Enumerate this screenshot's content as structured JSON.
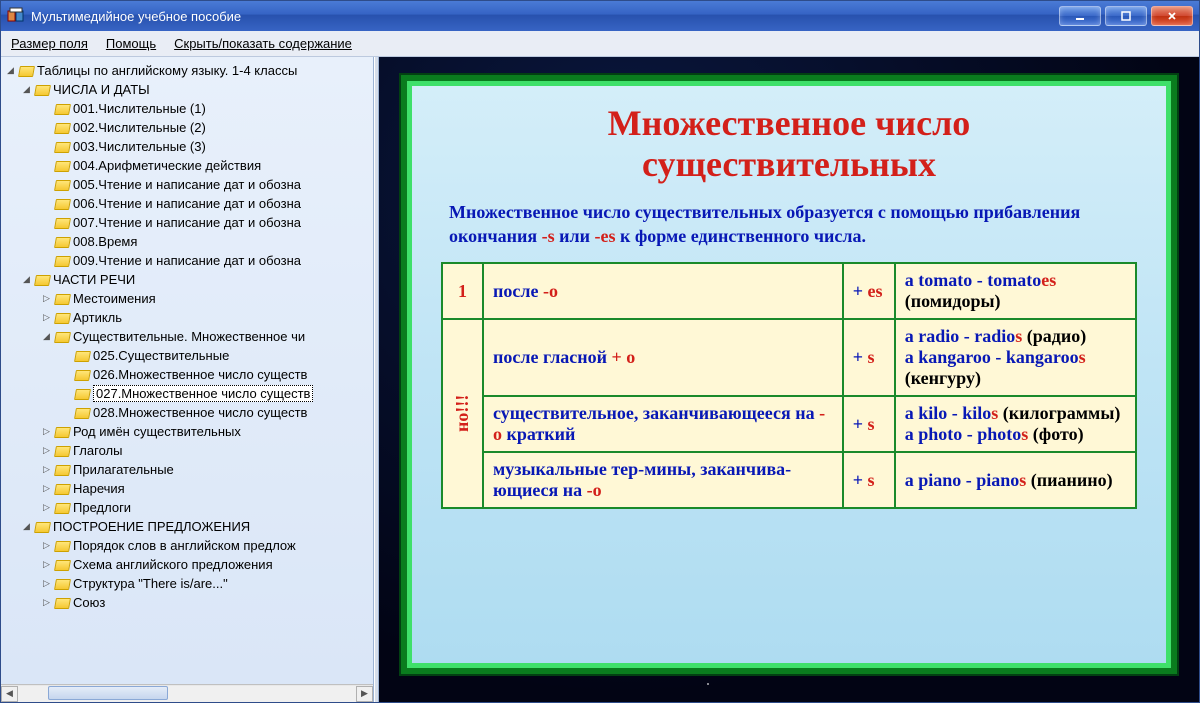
{
  "window": {
    "title": "Мультимедийное учебное пособие"
  },
  "menu": {
    "field_size": "Размер поля",
    "help": "Помощь",
    "toggle_toc": "Скрыть/показать содержание"
  },
  "tree": {
    "root": "Таблицы по английскому языку. 1-4 классы",
    "sec1": "ЧИСЛА И ДАТЫ",
    "s1_1": "001.Числительные (1)",
    "s1_2": "002.Числительные (2)",
    "s1_3": "003.Числительные (3)",
    "s1_4": "004.Арифметические действия",
    "s1_5": "005.Чтение и написание дат и обозна",
    "s1_6": "006.Чтение и написание дат и обозна",
    "s1_7": "007.Чтение и написание дат и обозна",
    "s1_8": "008.Время",
    "s1_9": "009.Чтение и написание дат и обозна",
    "sec2": "ЧАСТИ РЕЧИ",
    "s2_1": "Местоимения",
    "s2_2": "Артикль",
    "s2_3": "Существительные. Множественное чи",
    "s2_3_1": "025.Существительные",
    "s2_3_2": "026.Множественное число существ",
    "s2_3_3": "027.Множественное число существ",
    "s2_3_4": "028.Множественное число существ",
    "s2_4": "Род имён существительных",
    "s2_5": "Глаголы",
    "s2_6": "Прилагательные",
    "s2_7": "Наречия",
    "s2_8": "Предлоги",
    "sec3": "ПОСТРОЕНИЕ ПРЕДЛОЖЕНИЯ",
    "s3_1": "Порядок слов в английском предлож",
    "s3_2": "Схема английского предложения",
    "s3_3": "Структура \"There is/are...\"",
    "s3_4": "Союз"
  },
  "slide": {
    "title_l1": "Множественное число",
    "title_l2": "существительных",
    "intro_p1": "Множественное число существительных образуется с помощью прибавления окончания ",
    "intro_s": "-s",
    "intro_or": " или ",
    "intro_es": "-es",
    "intro_p2": " к форме единственного числа.",
    "row_num": "1",
    "vnote": "но!!!",
    "r1_cond_a": "после ",
    "r1_cond_b": "-o",
    "r1_suf_plus": "+ ",
    "r1_suf_es": "es",
    "r1_ex": "a tomato - tomato",
    "r1_ex_es": "es",
    "r1_ex_tr": " (помидоры)",
    "r2_cond_a": "после гласной ",
    "r2_cond_b": "+ o",
    "r2_suf_plus": "+ ",
    "r2_suf_s": "s",
    "r2_ex1": "a radio - radio",
    "r2_ex1_s": "s",
    "r2_ex1_tr": " (радио)",
    "r2_ex2": "a kangaroo - kangaroo",
    "r2_ex2_s": "s",
    "r2_ex2_tr": " (кенгуру)",
    "r3_cond_a": "существительное, заканчивающееся на ",
    "r3_cond_b": "-o",
    "r3_cond_c": " краткий",
    "r3_suf_plus": "+ ",
    "r3_suf_s": "s",
    "r3_ex1": "a kilo - kilo",
    "r3_ex1_s": "s",
    "r3_ex1_tr": " (килограммы)",
    "r3_ex2": "a photo - photo",
    "r3_ex2_s": "s",
    "r3_ex2_tr": " (фото)",
    "r4_cond_a": "музыкальные тер-мины, заканчива-ющиеся на ",
    "r4_cond_b": "-o",
    "r4_suf_plus": "+ ",
    "r4_suf_s": "s",
    "r4_ex": "a piano - piano",
    "r4_ex_s": "s",
    "r4_ex_tr": " (пианино)"
  }
}
